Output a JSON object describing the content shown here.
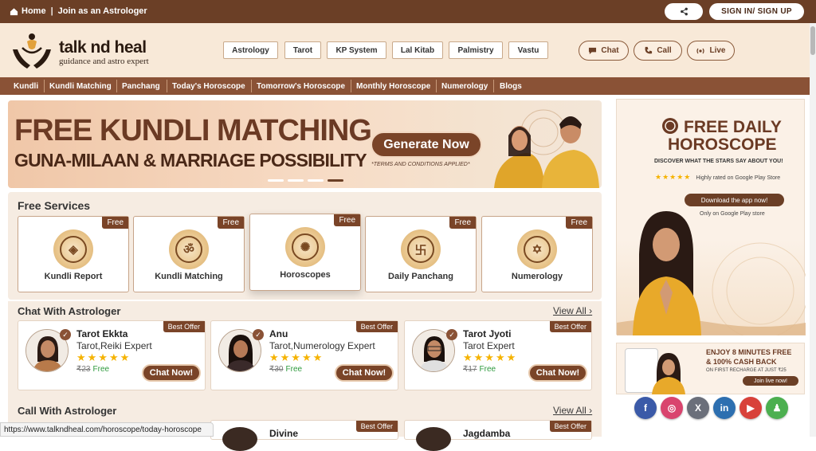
{
  "topbar": {
    "home_label": "Home",
    "separator": "|",
    "join_label": "Join as an Astrologer",
    "signin_label": "SIGN IN/ SIGN UP"
  },
  "logo": {
    "name": "talk nd heal",
    "tagline": "guidance and astro expert"
  },
  "header_pills": [
    "Astrology",
    "Tarot",
    "KP System",
    "Lal Kitab",
    "Palmistry",
    "Vastu"
  ],
  "header_actions": {
    "chat": "Chat",
    "call": "Call",
    "live": "Live"
  },
  "nav": [
    "Kundli",
    "Kundli Matching",
    "Panchang",
    "Today's Horoscope",
    "Tomorrow's Horoscope",
    "Monthly Horoscope",
    "Numerology",
    "Blogs"
  ],
  "banner": {
    "title": "FREE KUNDLI MATCHING",
    "subtitle": "GUNA-MILAAN & MARRIAGE POSSIBILITY",
    "button": "Generate Now",
    "terms": "*TERMS AND CONDITIONS APPLIED*"
  },
  "free_services": {
    "title": "Free Services",
    "badge": "Free",
    "items": [
      "Kundli Report",
      "Kundli Matching",
      "Horoscopes",
      "Daily Panchang",
      "Numerology"
    ]
  },
  "chat_section": {
    "title": "Chat With Astrologer",
    "view_all": "View All",
    "badge": "Best Offer",
    "stars": "★★★★★",
    "astrologers": [
      {
        "name": "Tarot Ekkta",
        "specialty": "Tarot,Reiki Expert",
        "price": "₹23",
        "free": "Free",
        "button": "Chat Now!"
      },
      {
        "name": "Anu",
        "specialty": "Tarot,Numerology Expert",
        "price": "₹30",
        "free": "Free",
        "button": "Chat Now!"
      },
      {
        "name": "Tarot Jyoti",
        "specialty": "Tarot Expert",
        "price": "₹17",
        "free": "Free",
        "button": "Chat Now!"
      }
    ]
  },
  "call_section": {
    "title": "Call With Astrologer",
    "view_all": "View All",
    "badge": "Best Offer",
    "astrologers": [
      {
        "name": "Divine"
      },
      {
        "name": "Jagdamba"
      }
    ]
  },
  "side_ad": {
    "line1": "FREE DAILY",
    "line2": "HOROSCOPE",
    "line3": "DISCOVER WHAT THE STARS SAY ABOUT YOU!",
    "rating_stars": "★★★★★",
    "rating_text": "Highly rated on Google Play Store",
    "download": "Download the app now!",
    "only_on": "Only on Google Play store"
  },
  "side_ad2": {
    "line1": "ENJOY 8 MINUTES FREE",
    "line2": "& 100% CASH BACK",
    "line3": "ON FIRST RECHARGE AT JUST ₹25",
    "button": "Join live now!"
  },
  "social": [
    "f",
    "◎",
    "X",
    "in",
    "▶",
    "♟"
  ],
  "status_url": "https://www.talkndheal.com/horoscope/today-horoscope",
  "colors": {
    "brand_brown": "#6b3f26",
    "nav_brown": "#8a5236",
    "cream": "#f8e9d8",
    "star": "#f5b301",
    "free_green": "#2e9a3d"
  }
}
